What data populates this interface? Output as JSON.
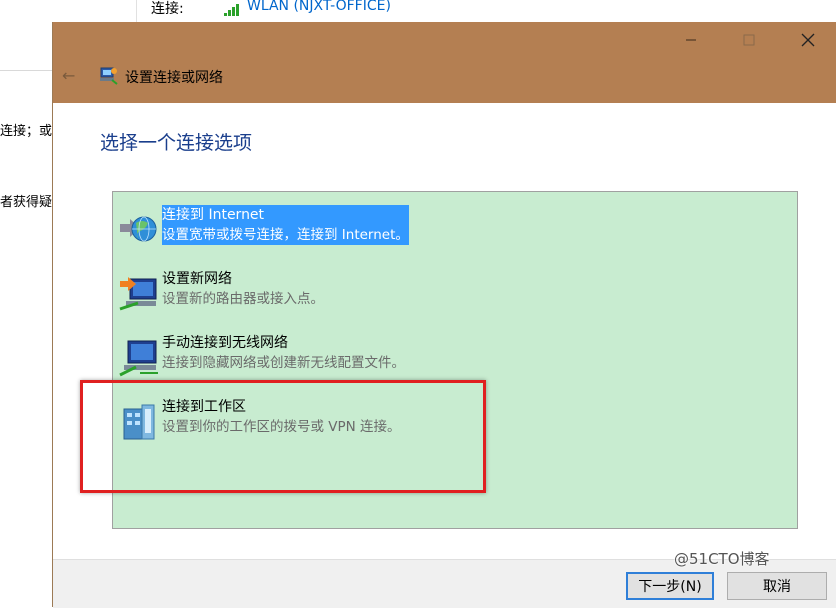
{
  "background": {
    "connection_label": "连接:",
    "wlan_name": "WLAN (NJXT-OFFICE)",
    "text_fragment_1": "连接；或",
    "text_fragment_2": "者获得疑"
  },
  "dialog": {
    "title": "设置连接或网络",
    "heading": "选择一个连接选项",
    "options": [
      {
        "title": "连接到 Internet",
        "description": "设置宽带或拨号连接，连接到 Internet。",
        "icon": "internet-globe-icon",
        "selected": true
      },
      {
        "title": "设置新网络",
        "description": "设置新的路由器或接入点。",
        "icon": "new-network-icon",
        "selected": false
      },
      {
        "title": "手动连接到无线网络",
        "description": "连接到隐藏网络或创建新无线配置文件。",
        "icon": "wireless-network-icon",
        "selected": false
      },
      {
        "title": "连接到工作区",
        "description": "设置到你的工作区的拨号或 VPN 连接。",
        "icon": "workplace-icon",
        "selected": false
      }
    ],
    "next_button": "下一步(N)",
    "cancel_button": "取消"
  },
  "watermark": "@51CTO博客",
  "colors": {
    "titlebar": "#b47f52",
    "listbox_bg": "#c8ecd0",
    "selection": "#3399ff",
    "heading": "#1a3e8c",
    "highlight_box": "#e02020",
    "link": "#0066cc"
  }
}
